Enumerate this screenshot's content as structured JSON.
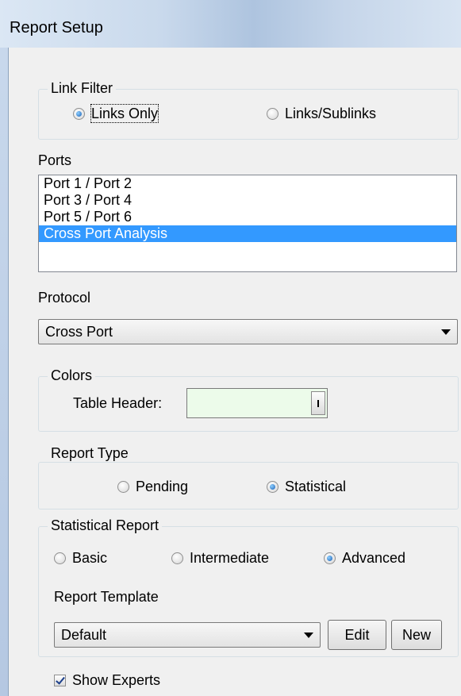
{
  "window": {
    "title": "Report Setup"
  },
  "link_filter": {
    "legend": "Link Filter",
    "options": [
      {
        "label": "Links Only",
        "selected": true
      },
      {
        "label": "Links/Sublinks",
        "selected": false
      }
    ]
  },
  "ports": {
    "label": "Ports",
    "items": [
      "Port 1 / Port 2",
      "Port 3 / Port 4",
      "Port 5 / Port 6",
      "Cross Port Analysis"
    ],
    "selected": "Cross Port Analysis"
  },
  "protocol": {
    "label": "Protocol",
    "value": "Cross Port"
  },
  "colors": {
    "legend": "Colors",
    "table_header_label": "Table Header:",
    "table_header_color": "#ecfbea"
  },
  "report_type": {
    "legend": "Report Type",
    "options": [
      {
        "label": "Pending",
        "selected": false
      },
      {
        "label": "Statistical",
        "selected": true
      }
    ]
  },
  "statistical_report": {
    "legend": "Statistical Report",
    "options": [
      {
        "label": "Basic",
        "selected": false
      },
      {
        "label": "Intermediate",
        "selected": false
      },
      {
        "label": "Advanced",
        "selected": true
      }
    ],
    "template_label": "Report Template",
    "template_value": "Default",
    "edit_label": "Edit",
    "new_label": "New"
  },
  "show_experts": {
    "label": "Show Experts",
    "checked": true
  },
  "colors_palette": {
    "selection": "#3399ff",
    "accent": "#1a5fb4"
  }
}
